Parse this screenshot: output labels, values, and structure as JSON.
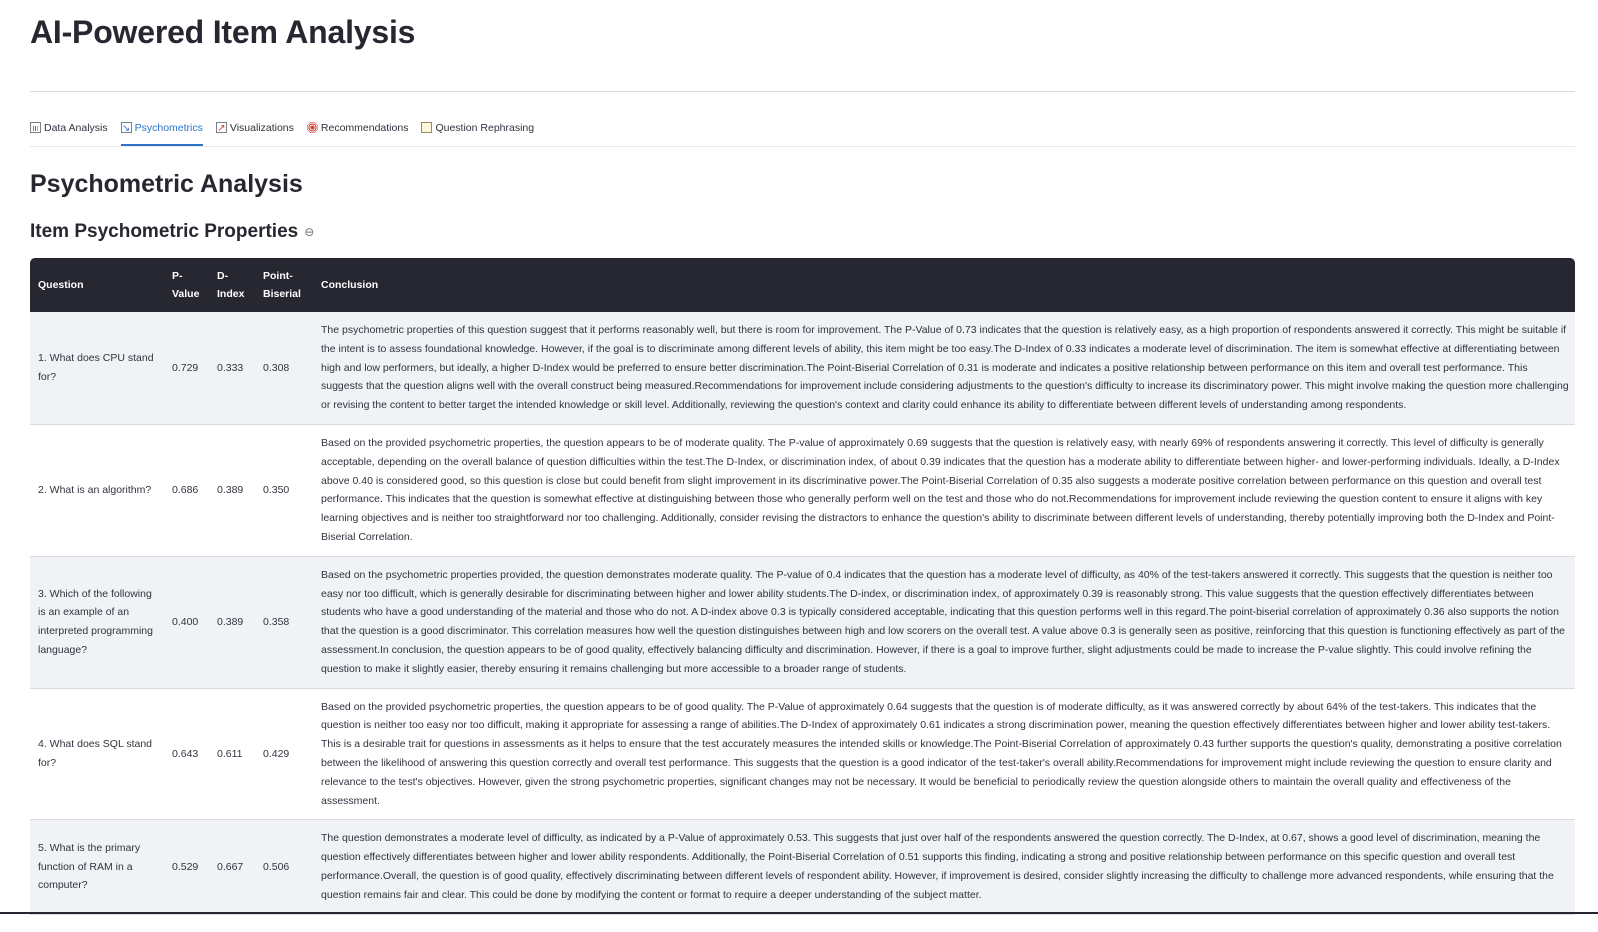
{
  "page_title": "AI-Powered Item Analysis",
  "tabs": [
    {
      "label": "Data Analysis",
      "icon": "bar-chart-icon",
      "active": false
    },
    {
      "label": "Psychometrics",
      "icon": "chart-decreasing-icon",
      "active": true
    },
    {
      "label": "Visualizations",
      "icon": "chart-increasing-icon",
      "active": false
    },
    {
      "label": "Recommendations",
      "icon": "target-icon",
      "active": false
    },
    {
      "label": "Question Rephrasing",
      "icon": "memo-icon",
      "active": false
    }
  ],
  "section_title": "Psychometric Analysis",
  "subsection_title": "Item Psychometric Properties",
  "table": {
    "headers": [
      "Question",
      "P-Value",
      "D-Index",
      "Point-Biserial",
      "Conclusion"
    ],
    "rows": [
      {
        "question": "1. What does CPU stand for?",
        "p_value": "0.729",
        "d_index": "0.333",
        "point_biserial": "0.308",
        "conclusion": "The psychometric properties of this question suggest that it performs reasonably well, but there is room for improvement. The P-Value of 0.73 indicates that the question is relatively easy, as a high proportion of respondents answered it correctly. This might be suitable if the intent is to assess foundational knowledge. However, if the goal is to discriminate among different levels of ability, this item might be too easy.The D-Index of 0.33 indicates a moderate level of discrimination. The item is somewhat effective at differentiating between high and low performers, but ideally, a higher D-Index would be preferred to ensure better discrimination.The Point-Biserial Correlation of 0.31 is moderate and indicates a positive relationship between performance on this item and overall test performance. This suggests that the question aligns well with the overall construct being measured.Recommendations for improvement include considering adjustments to the question's difficulty to increase its discriminatory power. This might involve making the question more challenging or revising the content to better target the intended knowledge or skill level. Additionally, reviewing the question's context and clarity could enhance its ability to differentiate between different levels of understanding among respondents."
      },
      {
        "question": "2. What is an algorithm?",
        "p_value": "0.686",
        "d_index": "0.389",
        "point_biserial": "0.350",
        "conclusion": "Based on the provided psychometric properties, the question appears to be of moderate quality. The P-value of approximately 0.69 suggests that the question is relatively easy, with nearly 69% of respondents answering it correctly. This level of difficulty is generally acceptable, depending on the overall balance of question difficulties within the test.The D-Index, or discrimination index, of about 0.39 indicates that the question has a moderate ability to differentiate between higher- and lower-performing individuals. Ideally, a D-Index above 0.40 is considered good, so this question is close but could benefit from slight improvement in its discriminative power.The Point-Biserial Correlation of 0.35 also suggests a moderate positive correlation between performance on this question and overall test performance. This indicates that the question is somewhat effective at distinguishing between those who generally perform well on the test and those who do not.Recommendations for improvement include reviewing the question content to ensure it aligns with key learning objectives and is neither too straightforward nor too challenging. Additionally, consider revising the distractors to enhance the question's ability to discriminate between different levels of understanding, thereby potentially improving both the D-Index and Point-Biserial Correlation."
      },
      {
        "question": "3. Which of the following is an example of an interpreted programming language?",
        "p_value": "0.400",
        "d_index": "0.389",
        "point_biserial": "0.358",
        "conclusion": "Based on the psychometric properties provided, the question demonstrates moderate quality. The P-value of 0.4 indicates that the question has a moderate level of difficulty, as 40% of the test-takers answered it correctly. This suggests that the question is neither too easy nor too difficult, which is generally desirable for discriminating between higher and lower ability students.The D-index, or discrimination index, of approximately 0.39 is reasonably strong. This value suggests that the question effectively differentiates between students who have a good understanding of the material and those who do not. A D-index above 0.3 is typically considered acceptable, indicating that this question performs well in this regard.The point-biserial correlation of approximately 0.36 also supports the notion that the question is a good discriminator. This correlation measures how well the question distinguishes between high and low scorers on the overall test. A value above 0.3 is generally seen as positive, reinforcing that this question is functioning effectively as part of the assessment.In conclusion, the question appears to be of good quality, effectively balancing difficulty and discrimination. However, if there is a goal to improve further, slight adjustments could be made to increase the P-value slightly. This could involve refining the question to make it slightly easier, thereby ensuring it remains challenging but more accessible to a broader range of students."
      },
      {
        "question": "4. What does SQL stand for?",
        "p_value": "0.643",
        "d_index": "0.611",
        "point_biserial": "0.429",
        "conclusion": "Based on the provided psychometric properties, the question appears to be of good quality. The P-Value of approximately 0.64 suggests that the question is of moderate difficulty, as it was answered correctly by about 64% of the test-takers. This indicates that the question is neither too easy nor too difficult, making it appropriate for assessing a range of abilities.The D-Index of approximately 0.61 indicates a strong discrimination power, meaning the question effectively differentiates between higher and lower ability test-takers. This is a desirable trait for questions in assessments as it helps to ensure that the test accurately measures the intended skills or knowledge.The Point-Biserial Correlation of approximately 0.43 further supports the question's quality, demonstrating a positive correlation between the likelihood of answering this question correctly and overall test performance. This suggests that the question is a good indicator of the test-taker's overall ability.Recommendations for improvement might include reviewing the question to ensure clarity and relevance to the test's objectives. However, given the strong psychometric properties, significant changes may not be necessary. It would be beneficial to periodically review the question alongside others to maintain the overall quality and effectiveness of the assessment."
      },
      {
        "question": "5. What is the primary function of RAM in a computer?",
        "p_value": "0.529",
        "d_index": "0.667",
        "point_biserial": "0.506",
        "conclusion": "The question demonstrates a moderate level of difficulty, as indicated by a P-Value of approximately 0.53. This suggests that just over half of the respondents answered the question correctly. The D-Index, at 0.67, shows a good level of discrimination, meaning the question effectively differentiates between higher and lower ability respondents. Additionally, the Point-Biserial Correlation of 0.51 supports this finding, indicating a strong and positive relationship between performance on this specific question and overall test performance.Overall, the question is of good quality, effectively discriminating between different levels of respondent ability. However, if improvement is desired, consider slightly increasing the difficulty to challenge more advanced respondents, while ensuring that the question remains fair and clear. This could be done by modifying the content or format to require a deeper understanding of the subject matter."
      }
    ]
  }
}
